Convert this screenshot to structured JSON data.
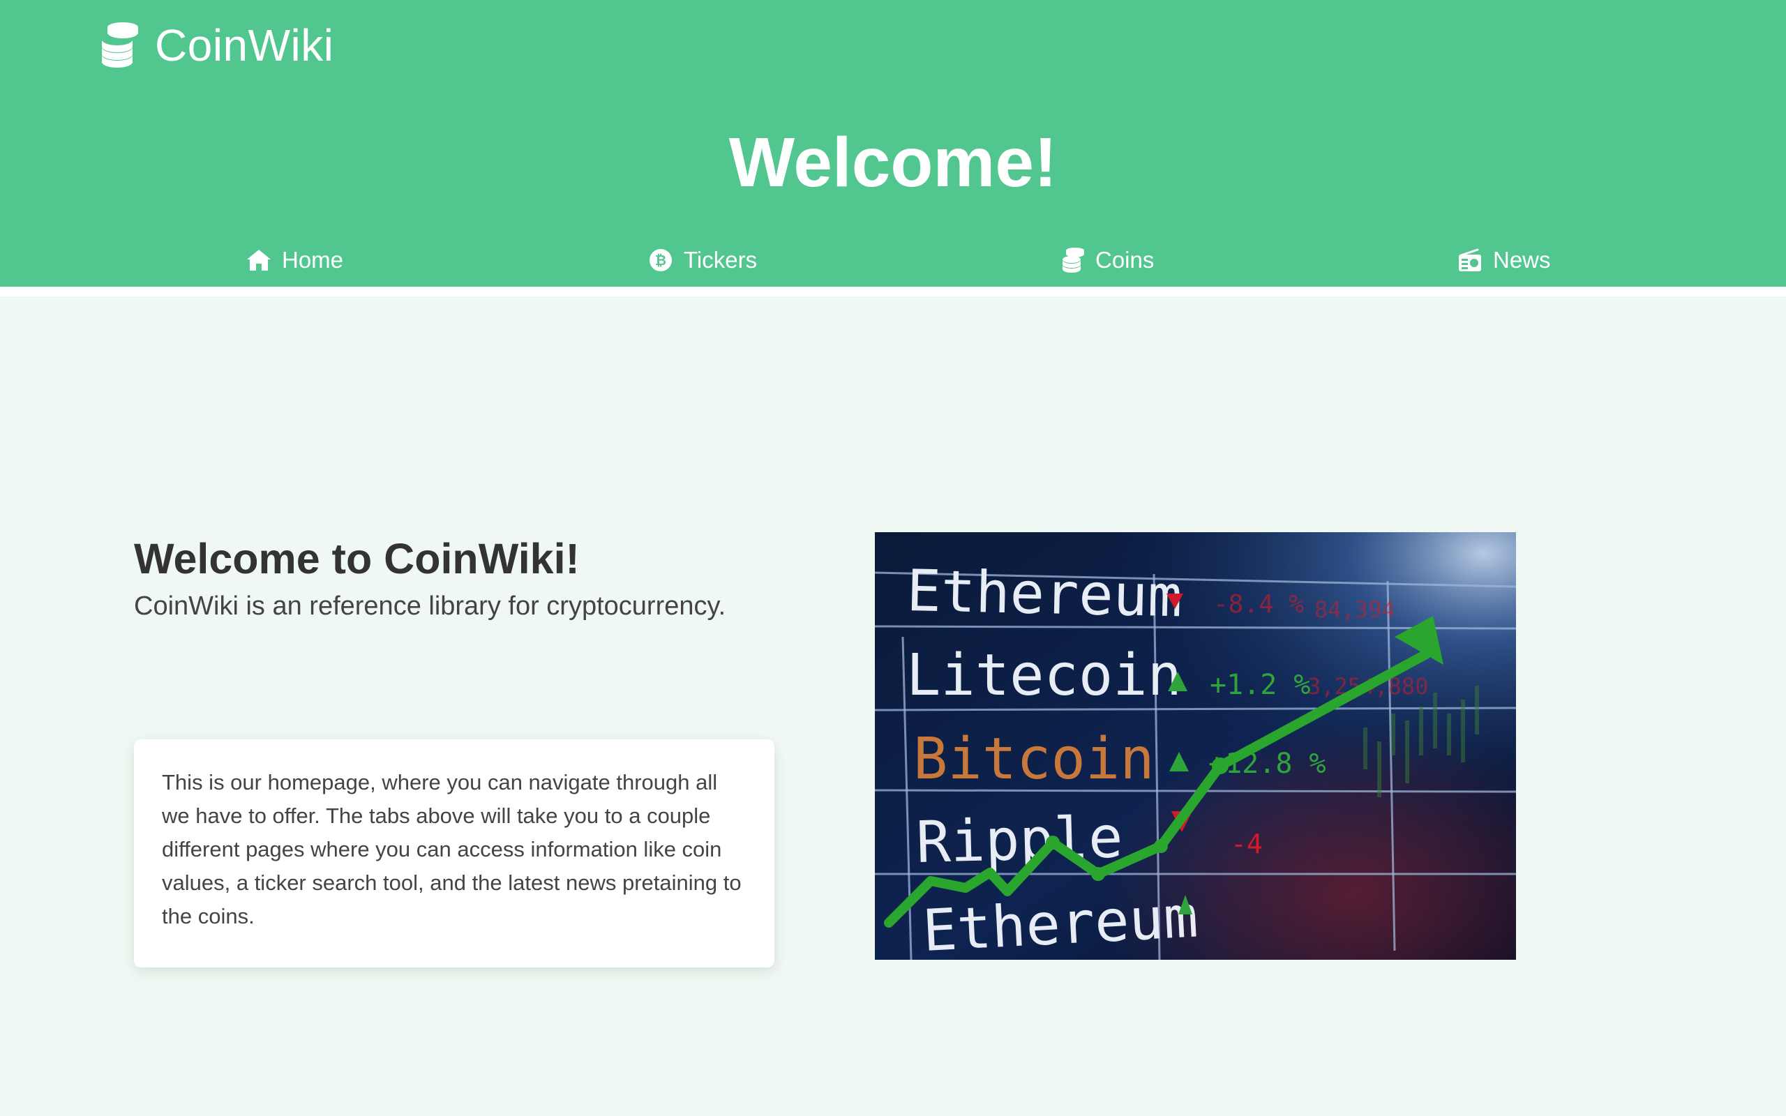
{
  "brand": {
    "name": "CoinWiki",
    "icon": "coins-icon",
    "color": "#51c78f"
  },
  "header": {
    "title": "Welcome!"
  },
  "nav": {
    "items": [
      {
        "label": "Home",
        "icon": "home-icon"
      },
      {
        "label": "Tickers",
        "icon": "bitcoin-icon"
      },
      {
        "label": "Coins",
        "icon": "coins-icon"
      },
      {
        "label": "News",
        "icon": "radio-icon"
      }
    ]
  },
  "main": {
    "heading": "Welcome to CoinWiki!",
    "subheading": "CoinWiki is an reference library for cryptocurrency.",
    "card_text": "This is our homepage, where you can navigate through all we have to offer. The tabs above will take you to a couple different pages where you can access information like coin values, a ticker search tool, and the latest news pretaining to the coins."
  },
  "hero_image": {
    "board_rows": [
      {
        "name": "Ethereum",
        "arrow": "down",
        "change": "-8.4 %",
        "volume": "84,394"
      },
      {
        "name": "Litecoin",
        "arrow": "up",
        "change": "+1.2 %",
        "volume": "3,254,880"
      },
      {
        "name": "Bitcoin",
        "arrow": "up",
        "change": "+12.8 %",
        "volume": ""
      },
      {
        "name": "Ripple",
        "arrow": "down",
        "change": "-4",
        "volume": ""
      },
      {
        "name": "Ethereum",
        "arrow": "up",
        "change": "",
        "volume": ""
      }
    ],
    "colors": {
      "up": "#2fa43a",
      "down": "#d11b2a",
      "bitcoin": "#c8783a",
      "text": "#e8edf5"
    }
  }
}
